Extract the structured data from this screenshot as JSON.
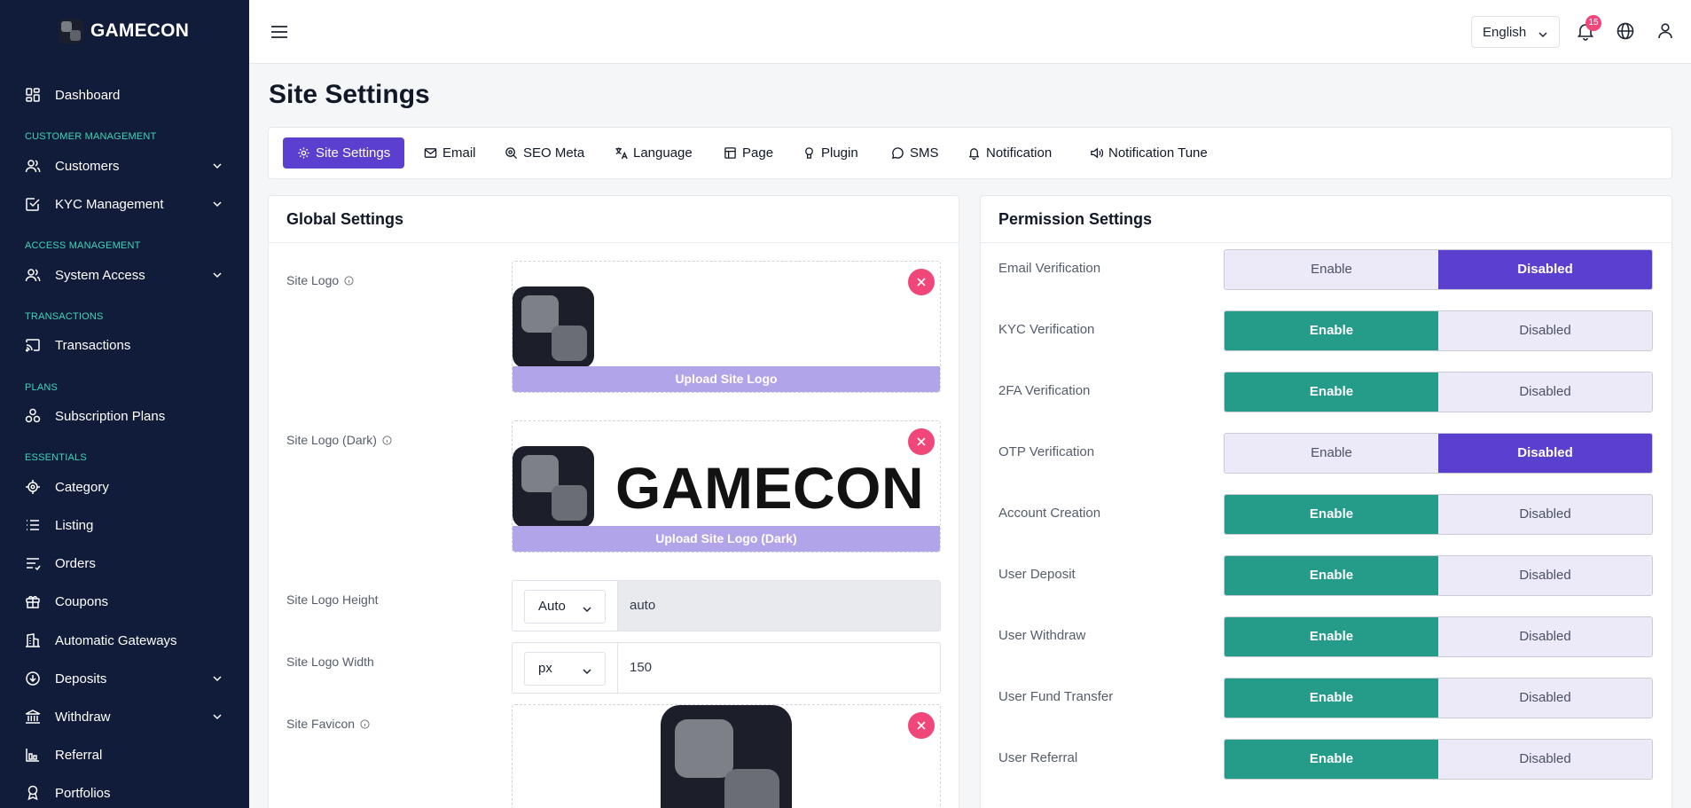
{
  "brand": {
    "name": "GAMECON"
  },
  "sidebar": {
    "items": [
      {
        "label": "Dashboard"
      },
      {
        "section": "CUSTOMER MANAGEMENT"
      },
      {
        "label": "Customers"
      },
      {
        "label": "KYC Management"
      },
      {
        "section": "ACCESS MANAGEMENT"
      },
      {
        "label": "System Access"
      },
      {
        "section": "TRANSACTIONS"
      },
      {
        "label": "Transactions"
      },
      {
        "section": "PLANS"
      },
      {
        "label": "Subscription Plans"
      },
      {
        "section": "ESSENTIALS"
      },
      {
        "label": "Category"
      },
      {
        "label": "Listing"
      },
      {
        "label": "Orders"
      },
      {
        "label": "Coupons"
      },
      {
        "label": "Automatic Gateways"
      },
      {
        "label": "Deposits"
      },
      {
        "label": "Withdraw"
      },
      {
        "label": "Referral"
      },
      {
        "label": "Portfolios"
      }
    ]
  },
  "topbar": {
    "language": "English",
    "notification_count": "15"
  },
  "page": {
    "title": "Site Settings"
  },
  "tabs": [
    {
      "label": "Site Settings",
      "icon": "gear-icon",
      "active": true
    },
    {
      "label": "Email",
      "icon": "mail-icon"
    },
    {
      "label": "SEO Meta",
      "icon": "seo-search-icon"
    },
    {
      "label": "Language",
      "icon": "translate-icon"
    },
    {
      "label": "Page",
      "icon": "page-layout-icon"
    },
    {
      "label": "Plugin",
      "icon": "plugin-icon"
    },
    {
      "label": "SMS",
      "icon": "chat-bubble-icon"
    },
    {
      "label": "Notification",
      "icon": "bell-icon"
    },
    {
      "label": "Notification Tune",
      "icon": "speaker-icon"
    }
  ],
  "global": {
    "title": "Global Settings",
    "site_logo_label": "Site Logo",
    "site_logo_button": "Upload Site Logo",
    "site_logo_dark_label": "Site Logo (Dark)",
    "site_logo_dark_text": "GAMECON",
    "site_logo_dark_button": "Upload Site Logo (Dark)",
    "logo_height_label": "Site Logo Height",
    "logo_height_unit": "Auto",
    "logo_height_value": "auto",
    "logo_width_label": "Site Logo Width",
    "logo_width_unit": "px",
    "logo_width_value": "150",
    "favicon_label": "Site Favicon"
  },
  "permission": {
    "title": "Permission Settings",
    "enable_label": "Enable",
    "disabled_label": "Disabled",
    "rows": [
      {
        "label": "Email Verification",
        "state": "Disabled"
      },
      {
        "label": "KYC Verification",
        "state": "Enable"
      },
      {
        "label": "2FA Verification",
        "state": "Enable"
      },
      {
        "label": "OTP Verification",
        "state": "Disabled"
      },
      {
        "label": "Account Creation",
        "state": "Enable"
      },
      {
        "label": "User Deposit",
        "state": "Enable"
      },
      {
        "label": "User Withdraw",
        "state": "Enable"
      },
      {
        "label": "User Fund Transfer",
        "state": "Enable"
      },
      {
        "label": "User Referral",
        "state": "Enable"
      }
    ]
  },
  "colors": {
    "sidebar": "#111c3a",
    "accent": "#5b3fcf",
    "enable": "#259b89",
    "section": "#3fd6b6",
    "danger": "#f0467a"
  }
}
